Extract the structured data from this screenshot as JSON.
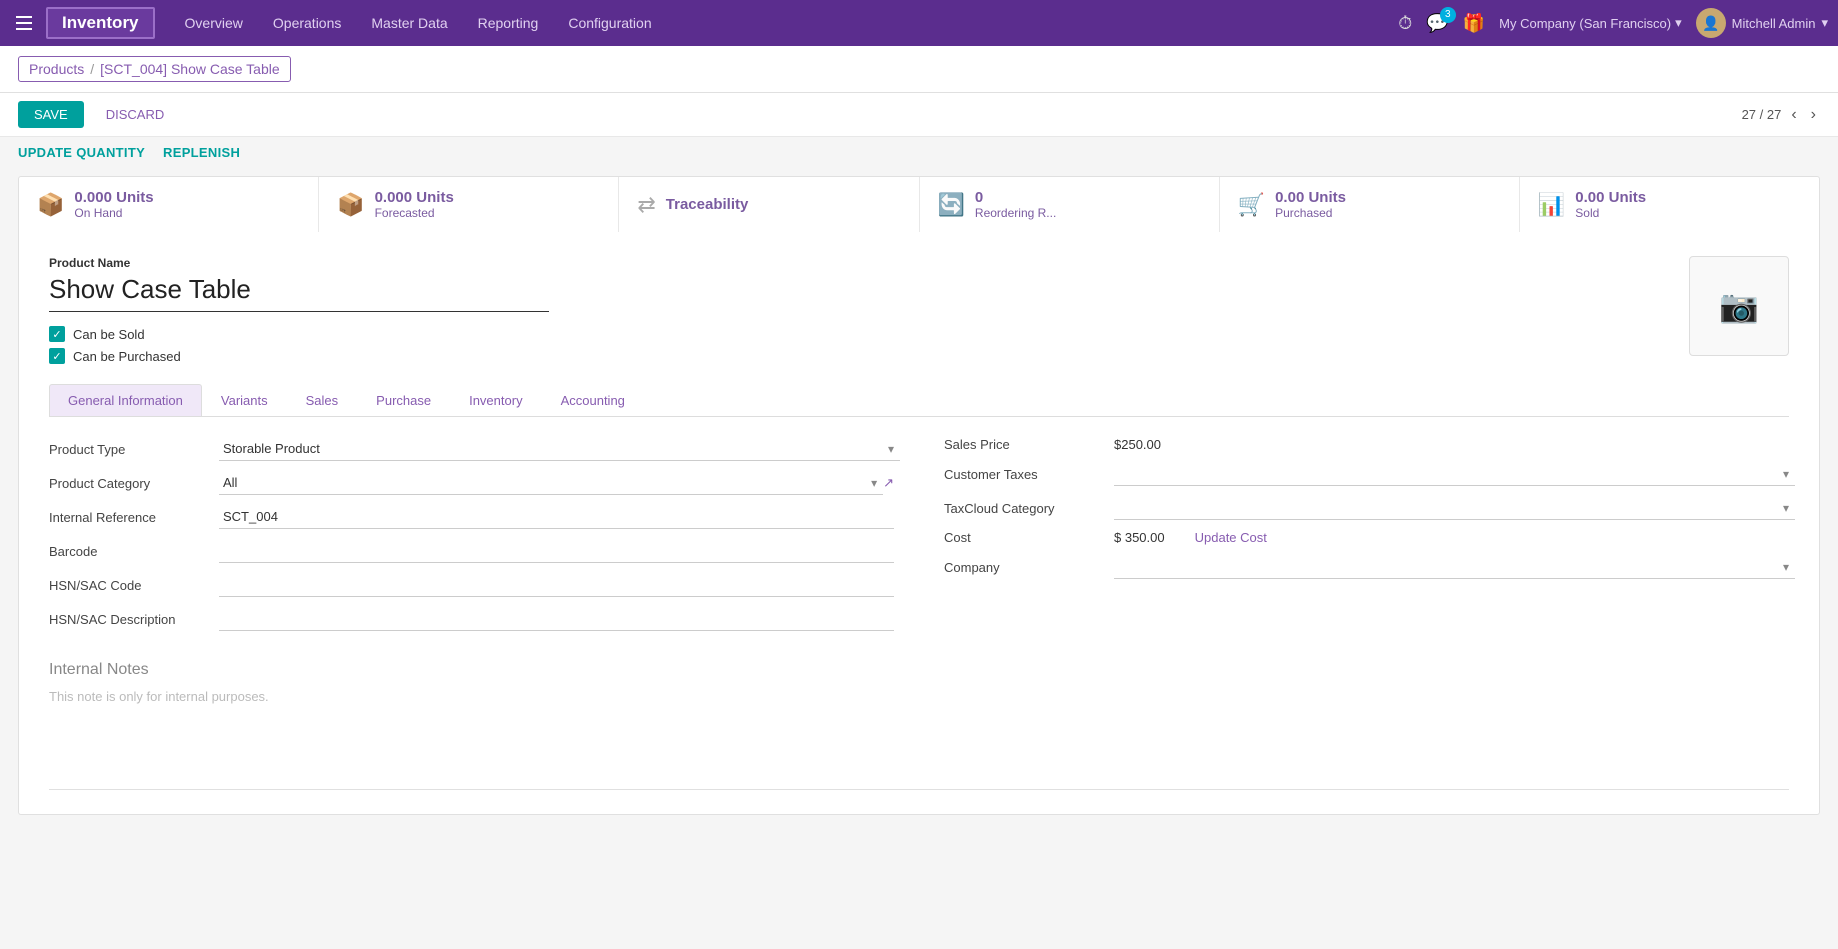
{
  "topnav": {
    "app_name": "Inventory",
    "menu_items": [
      "Overview",
      "Operations",
      "Master Data",
      "Reporting",
      "Configuration"
    ],
    "notification_count": "3",
    "company": "My Company (San Francisco)",
    "user": "Mitchell Admin"
  },
  "breadcrumb": {
    "parent": "Products",
    "separator": "/",
    "current": "[SCT_004] Show Case Table"
  },
  "actions": {
    "save": "SAVE",
    "discard": "DISCARD",
    "pagination_current": "27",
    "pagination_total": "27"
  },
  "subactions": {
    "update_quantity": "UPDATE QUANTITY",
    "replenish": "REPLENISH"
  },
  "stats": [
    {
      "icon": "📦",
      "value": "0.000 Units",
      "label": "On Hand"
    },
    {
      "icon": "📦",
      "value": "0.000 Units",
      "label": "Forecasted"
    },
    {
      "icon": "⇄",
      "value": "Traceability",
      "label": ""
    },
    {
      "icon": "🔄",
      "value": "0",
      "label": "Reordering R..."
    },
    {
      "icon": "🛒",
      "value": "0.00 Units",
      "label": "Purchased"
    },
    {
      "icon": "📊",
      "value": "0.00 Units",
      "label": "Sold"
    }
  ],
  "product": {
    "name_label": "Product Name",
    "name": "Show Case Table",
    "can_be_sold": "Can be Sold",
    "can_be_purchased": "Can be Purchased"
  },
  "tabs": [
    {
      "id": "general",
      "label": "General Information",
      "active": true
    },
    {
      "id": "variants",
      "label": "Variants",
      "active": false
    },
    {
      "id": "sales",
      "label": "Sales",
      "active": false
    },
    {
      "id": "purchase",
      "label": "Purchase",
      "active": false
    },
    {
      "id": "inventory",
      "label": "Inventory",
      "active": false
    },
    {
      "id": "accounting",
      "label": "Accounting",
      "active": false
    }
  ],
  "form": {
    "left": {
      "product_type_label": "Product Type",
      "product_type_value": "Storable Product",
      "product_category_label": "Product Category",
      "product_category_value": "All",
      "internal_reference_label": "Internal Reference",
      "internal_reference_value": "SCT_004",
      "barcode_label": "Barcode",
      "barcode_value": "",
      "hsn_sac_code_label": "HSN/SAC Code",
      "hsn_sac_code_value": "",
      "hsn_sac_desc_label": "HSN/SAC Description",
      "hsn_sac_desc_value": ""
    },
    "right": {
      "sales_price_label": "Sales Price",
      "sales_price_value": "$250.00",
      "customer_taxes_label": "Customer Taxes",
      "customer_taxes_value": "",
      "taxcloud_category_label": "TaxCloud Category",
      "taxcloud_category_value": "",
      "cost_label": "Cost",
      "cost_value": "$ 350.00",
      "update_cost_label": "Update Cost",
      "company_label": "Company",
      "company_value": ""
    }
  },
  "internal_notes": {
    "title": "Internal Notes",
    "placeholder": "This note is only for internal purposes."
  }
}
